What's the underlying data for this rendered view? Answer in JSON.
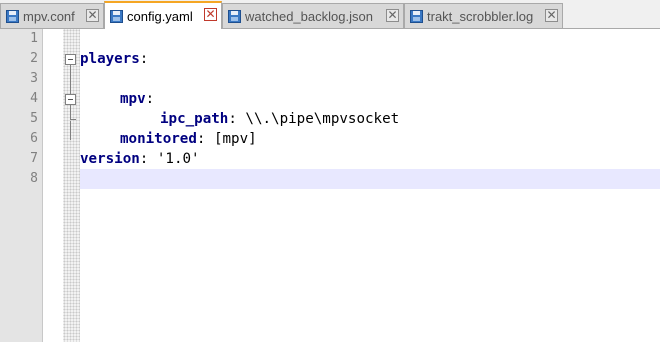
{
  "tabs": [
    {
      "label": "mpv.conf",
      "active": false,
      "icon": "save-disk-icon"
    },
    {
      "label": "config.yaml",
      "active": true,
      "icon": "save-disk-icon"
    },
    {
      "label": "watched_backlog.json",
      "active": false,
      "icon": "save-disk-icon"
    },
    {
      "label": "trakt_scrobbler.log",
      "active": false,
      "icon": "save-disk-icon"
    }
  ],
  "close_glyph": "✕",
  "editor": {
    "line_numbers": [
      "1",
      "2",
      "3",
      "4",
      "5",
      "6",
      "7",
      "8"
    ],
    "current_line": 8,
    "lines": [
      {
        "key": "",
        "sep": "",
        "value": ""
      },
      {
        "key": "players",
        "sep": ":",
        "value": ""
      },
      {
        "key": "",
        "sep": "",
        "value": ""
      },
      {
        "key": "mpv",
        "sep": ":",
        "value": ""
      },
      {
        "key": "ipc_path",
        "sep": ":",
        "value": " \\\\.\\pipe\\mpvsocket"
      },
      {
        "key": "monitored",
        "sep": ":",
        "value": " [mpv]"
      },
      {
        "key": "version",
        "sep": ":",
        "value": " '1.0'"
      },
      {
        "key": "",
        "sep": "",
        "value": ""
      }
    ]
  },
  "colors": {
    "yaml_key": "#000080",
    "active_tab_accent": "#f5a623",
    "current_line_highlight": "#e8e8ff",
    "save_icon": "#3a78c4"
  }
}
